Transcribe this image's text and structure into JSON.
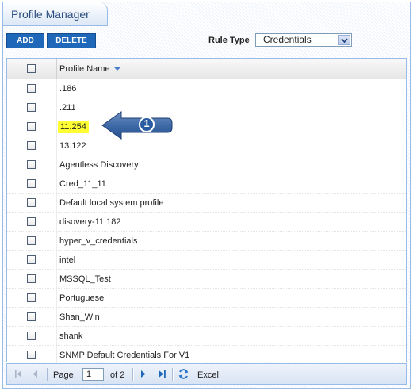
{
  "panel": {
    "title": "Profile Manager"
  },
  "toolbar": {
    "add_label": "ADD",
    "delete_label": "DELETE",
    "rule_type_label": "Rule Type",
    "rule_type_value": "Credentials"
  },
  "grid": {
    "column_header": "Profile Name",
    "sort_direction": "descending",
    "rows": [
      {
        "name": ".186"
      },
      {
        "name": ".211"
      },
      {
        "name": "11.254",
        "highlighted": true
      },
      {
        "name": "13.122"
      },
      {
        "name": "Agentless Discovery"
      },
      {
        "name": "Cred_11_11"
      },
      {
        "name": "Default local system profile"
      },
      {
        "name": "disovery-11.182"
      },
      {
        "name": "hyper_v_credentials"
      },
      {
        "name": "intel"
      },
      {
        "name": "MSSQL_Test"
      },
      {
        "name": "Portuguese"
      },
      {
        "name": "Shan_Win"
      },
      {
        "name": "shank"
      },
      {
        "name": "SNMP Default Credentials For V1"
      }
    ]
  },
  "pager": {
    "page_label": "Page",
    "page_value": "1",
    "of_label": "of 2",
    "excel_label": "Excel"
  },
  "callout": {
    "number": "1"
  },
  "colors": {
    "accent": "#1f67b8",
    "border": "#99bbe8",
    "highlight": "#ffff33",
    "callout": "#2f5c9a"
  }
}
